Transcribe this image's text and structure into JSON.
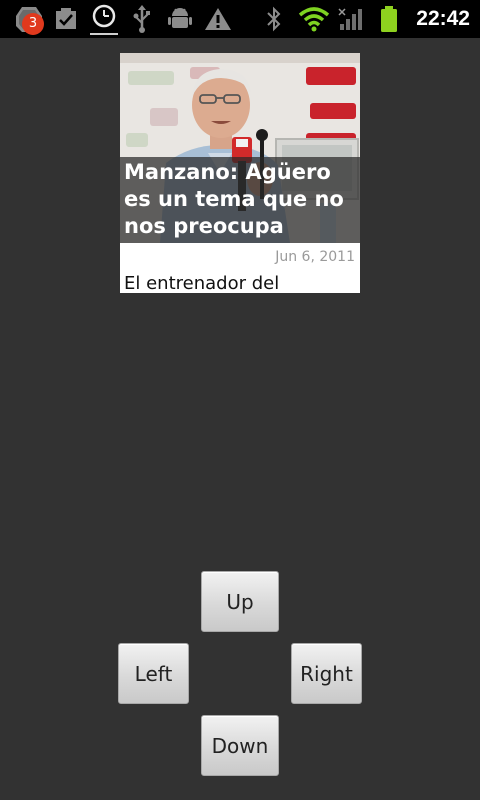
{
  "status_bar": {
    "notification_count": "3",
    "time": "22:42",
    "icons": [
      "notification-app-icon",
      "checkbox-task-icon",
      "clock-icon",
      "usb-icon",
      "android-debug-icon",
      "warning-icon",
      "bluetooth-icon",
      "wifi-icon",
      "signal-icon",
      "battery-icon"
    ],
    "colors": {
      "wifi": "#7ed321",
      "battery": "#8ed11f",
      "badge": "#e0391d"
    }
  },
  "article": {
    "headline": "Manzano: Agüero es un tema que no nos preocupa",
    "date": "Jun 6, 2011",
    "snippet": "El entrenador del"
  },
  "controls": {
    "up_label": "Up",
    "left_label": "Left",
    "right_label": "Right",
    "down_label": "Down"
  }
}
